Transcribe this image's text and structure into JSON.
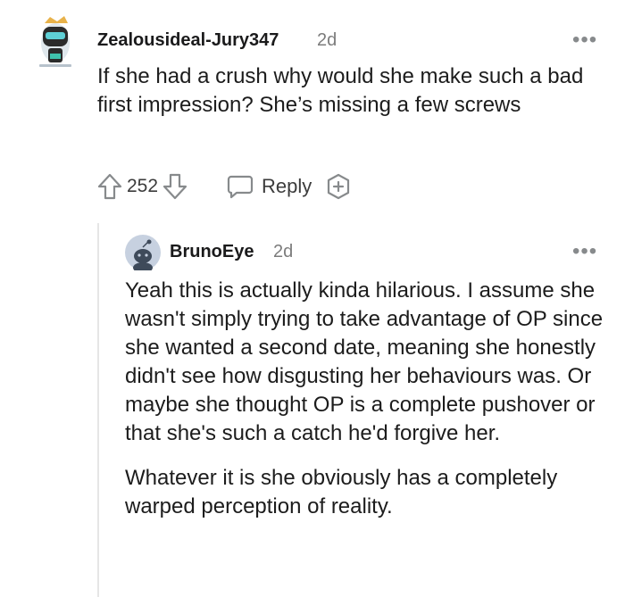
{
  "comments": [
    {
      "username": "Zealousideal-Jury347",
      "age": "2d",
      "more_label": "•••",
      "body": "If she had a crush why would she make such a bad first impression? She’s missing a few screws",
      "vote_count": "252",
      "reply_label": "Reply",
      "icons": {
        "upvote": "arrow-up-icon",
        "downvote": "arrow-down-icon",
        "reply": "speech-bubble-icon",
        "award": "award-plus-icon"
      }
    },
    {
      "username": "BrunoEye",
      "age": "2d",
      "more_label": "•••",
      "paragraphs": [
        "Yeah this is actually kinda hilarious. I assume she wasn't simply trying to take advantage of OP since she wanted a second date, meaning she honestly didn't see how disgusting her behaviours was. Or maybe she thought OP is a complete pushover or that she's such a catch he'd forgive her.",
        "Whatever it is she obviously has a completely warped perception of reality."
      ]
    }
  ],
  "colors": {
    "text": "#1c1c1c",
    "meta": "#7c7c7c",
    "icon": "#878a8c",
    "thread_line": "#e6e6e6",
    "default_avatar": "#c7d1e0"
  }
}
